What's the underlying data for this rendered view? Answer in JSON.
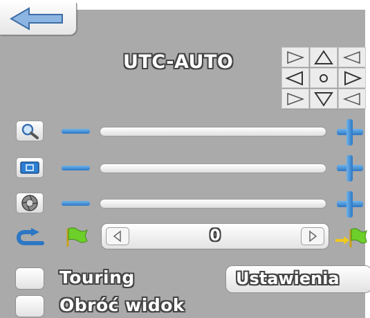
{
  "header": {
    "back_icon": "back-arrow-icon",
    "mode_label": "UTC-AUTO"
  },
  "ptz": {
    "buttons": [
      {
        "name": "up-left",
        "glyph": "◁◸"
      },
      {
        "name": "up",
        "glyph": "△"
      },
      {
        "name": "up-right",
        "glyph": "◹"
      },
      {
        "name": "left",
        "glyph": "◁"
      },
      {
        "name": "center",
        "glyph": "○"
      },
      {
        "name": "right",
        "glyph": "▷"
      },
      {
        "name": "down-left",
        "glyph": "◺"
      },
      {
        "name": "down",
        "glyph": "▽"
      },
      {
        "name": "down-right",
        "glyph": "◿"
      }
    ]
  },
  "sliders": [
    {
      "name": "zoom",
      "icon": "magnifier-icon"
    },
    {
      "name": "focus",
      "icon": "focus-icon"
    },
    {
      "name": "iris",
      "icon": "iris-icon"
    }
  ],
  "preset": {
    "value": "0",
    "icons": [
      "return-icon",
      "flag-icon",
      "goto-flag-icon"
    ]
  },
  "options": {
    "touring_label": "Touring",
    "rotate_label": "Obróć widok",
    "settings_label": "Ustawienia"
  },
  "colors": {
    "panel_bg": "#aaaaaa",
    "accent_blue": "#2c77c4",
    "flag_green": "#6dcf2a",
    "arrow_yellow": "#f0c91a"
  }
}
